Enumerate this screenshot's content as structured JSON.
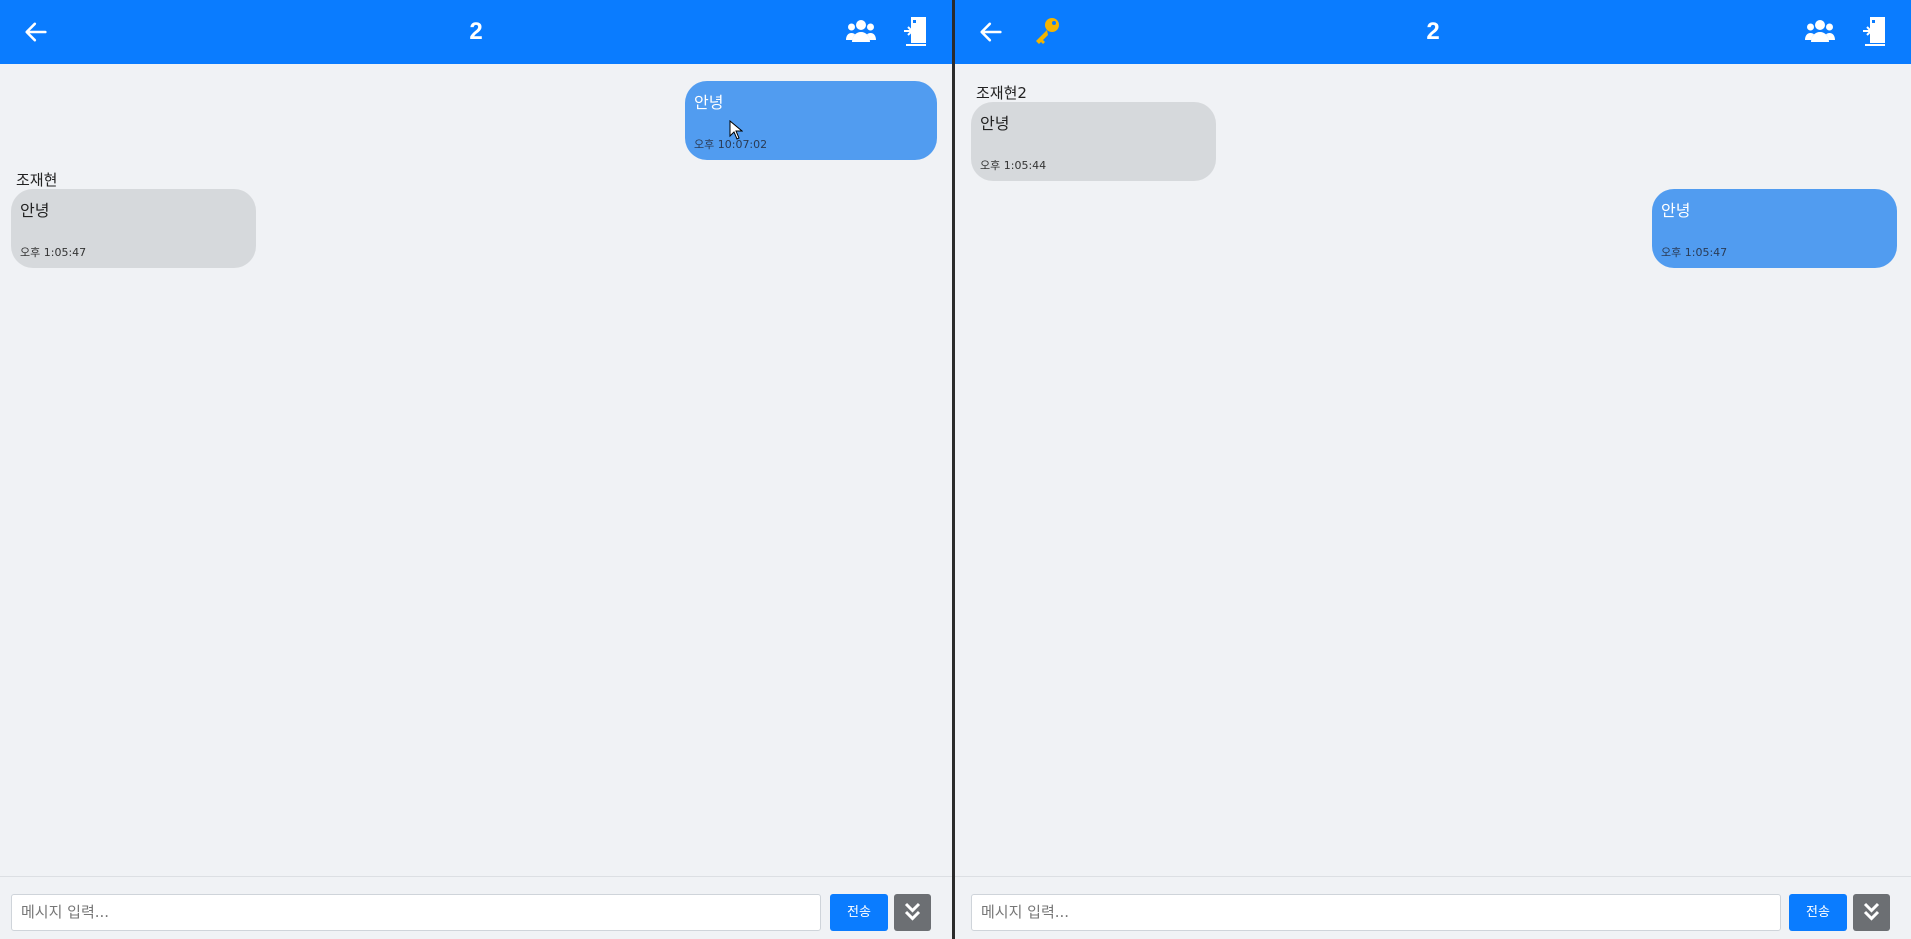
{
  "colors": {
    "header": "#0a7cff",
    "mine_bubble": "#519cf0",
    "other_bubble": "#d6d9dc",
    "key": "#f4b400"
  },
  "left": {
    "header": {
      "title": "2",
      "back_icon": "arrow-left-icon",
      "users_icon": "users-icon",
      "exit_icon": "door-exit-icon"
    },
    "messages": [
      {
        "mine": true,
        "text": "안녕",
        "time": "오후 10:07:02"
      },
      {
        "mine": false,
        "sender": "조재현",
        "text": "안녕",
        "time": "오후 1:05:47"
      }
    ],
    "footer": {
      "placeholder": "메시지 입력...",
      "send": "전송",
      "scroll_icon": "double-chevron-down-icon"
    }
  },
  "right": {
    "header": {
      "title": "2",
      "back_icon": "arrow-left-icon",
      "key_icon": "key-icon",
      "users_icon": "users-icon",
      "exit_icon": "door-exit-icon"
    },
    "messages": [
      {
        "mine": false,
        "sender": "조재현2",
        "text": "안녕",
        "time": "오후 1:05:44"
      },
      {
        "mine": true,
        "text": "안녕",
        "time": "오후 1:05:47"
      }
    ],
    "footer": {
      "placeholder": "메시지 입력...",
      "send": "전송",
      "scroll_icon": "double-chevron-down-icon"
    }
  }
}
